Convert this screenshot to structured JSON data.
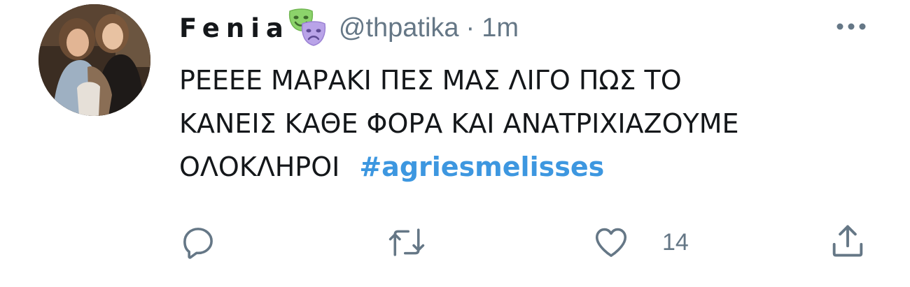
{
  "tweet": {
    "display_name": "Fenia",
    "name_icon": "performing-arts-masks-icon",
    "handle": "@thpatika",
    "separator": "·",
    "time": "1m",
    "more_icon": "more-dots-icon",
    "text_lines": [
      "ΡΕΕΕΕ ΜΑΡΑΚΙ ΠΕΣ ΜΑΣ ΛΙΓΟ ΠΩΣ ΤΟ",
      "ΚΑΝΕΙΣ ΚΑΘΕ ΦΟΡΑ ΚΑΙ ΑΝΑΤΡΙΧΙΑΖΟΥΜΕ",
      "ΟΛΟΚΛΗΡΟΙ"
    ],
    "hashtag": "#agriesmelisses",
    "actions": {
      "reply_icon": "reply-icon",
      "retweet_icon": "retweet-icon",
      "like_icon": "heart-icon",
      "like_count": "14",
      "share_icon": "share-icon"
    }
  },
  "colors": {
    "text": "#14171a",
    "secondary": "#657786",
    "hashtag": "#3d97e0",
    "mask_green": "#8cd36b",
    "mask_purple": "#b9a3e8"
  }
}
